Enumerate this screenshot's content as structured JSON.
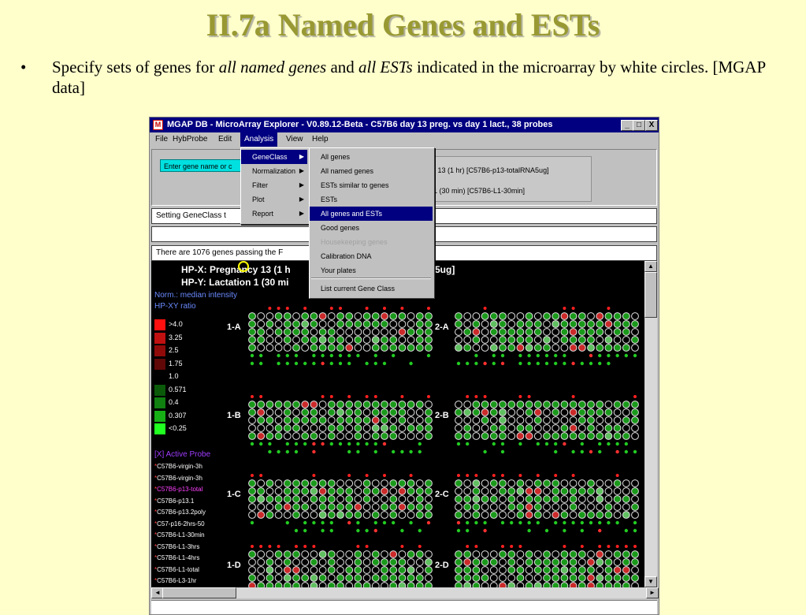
{
  "slide": {
    "title": "II.7a Named Genes and ESTs",
    "bullet": "•",
    "text_1": "Specify sets of  genes for ",
    "em_1": "all named genes",
    "text_2": " and ",
    "em_2": "all ESTs",
    "text_3": " indicated in the microarray by white circles. [MGAP data]"
  },
  "window": {
    "title": "MGAP DB - MicroArray Explorer - V0.89.12-Beta - C57B6 day 13 preg. vs day 1 lact., 38 probes",
    "controls": [
      "_",
      "□",
      "X"
    ]
  },
  "menubar": [
    {
      "label": "File"
    },
    {
      "label": "HybProbe"
    },
    {
      "label": "Edit"
    },
    {
      "label": "Analysis"
    },
    {
      "label": "View"
    },
    {
      "label": "Help"
    }
  ],
  "toolbar": {
    "gene_input_placeholder": "Enter gene name or c",
    "probe_x": "r 13  (1 hr) [C57B6-p13-totalRNA5ug]",
    "probe_y": "1  (30 min) [C57B6-L1-30min]"
  },
  "messages": {
    "status_1": "Setting GeneClass t",
    "status_2": "",
    "status_3": "There are 1076 genes passing the F"
  },
  "analysis_menu": [
    {
      "label": "GeneClass",
      "submenu": true
    },
    {
      "label": "Normalization",
      "submenu": true
    },
    {
      "label": "Filter",
      "submenu": true
    },
    {
      "label": "Plot",
      "submenu": true
    },
    {
      "label": "Report",
      "submenu": true
    }
  ],
  "geneclass_menu": [
    {
      "label": "All genes"
    },
    {
      "label": "All named genes"
    },
    {
      "label": "ESTs similar to genes"
    },
    {
      "label": "ESTs"
    },
    {
      "label": "All genes and ESTs",
      "highlighted": true
    },
    {
      "label": "Good genes"
    },
    {
      "label": "Housekeeping genes",
      "disabled": true
    },
    {
      "label": "Calibration DNA"
    },
    {
      "label": "Your plates"
    },
    {
      "label": "List current Gene Class",
      "separator_before": true
    }
  ],
  "canvas": {
    "hp_x": "HP-X: Pregnancy 13  (1 h",
    "hp_x_tail": "5ug]",
    "hp_y": "HP-Y: Lactation 1  (30 mi",
    "norm": "Norm.: median intensity",
    "ratio": "HP-XY ratio",
    "legend": [
      {
        "label": ">4.0",
        "color": "#ff1010"
      },
      {
        "label": "3.25",
        "color": "#c01010"
      },
      {
        "label": "2.5",
        "color": "#900a0a"
      },
      {
        "label": "1.75",
        "color": "#600808"
      },
      {
        "label": "1.0",
        "color": "#000000"
      },
      {
        "label": "0.571",
        "color": "#0a5a0a"
      },
      {
        "label": "0.4",
        "color": "#108010"
      },
      {
        "label": "0.307",
        "color": "#16b016"
      },
      {
        "label": "<0.25",
        "color": "#20ff20"
      }
    ],
    "active_probe": "[X] Active Probe",
    "probes": [
      {
        "label": "C57B6-virgin-3h"
      },
      {
        "label": "C57B6-virgin-3h"
      },
      {
        "label": "C57B6-p13-total",
        "active": true
      },
      {
        "label": "C57B6-p13.1"
      },
      {
        "label": "C57B6-p13.2poly"
      },
      {
        "label": "C57-p16-2hrs-50"
      },
      {
        "label": "C57B6-L1-30min"
      },
      {
        "label": "C57B6-L1-3hrs"
      },
      {
        "label": "C57B6-L1-4hrs"
      },
      {
        "label": "C57B6-L1-total"
      },
      {
        "label": "C57B6-L3-1hr"
      }
    ],
    "blocks": [
      {
        "label": "1-A"
      },
      {
        "label": "2-A"
      },
      {
        "label": "1-B"
      },
      {
        "label": "2-B"
      },
      {
        "label": "1-C"
      },
      {
        "label": "2-C"
      },
      {
        "label": "1-D"
      },
      {
        "label": "2-D"
      }
    ]
  },
  "scroll": {
    "up": "▲",
    "down": "▼",
    "left": "◄",
    "right": "►"
  }
}
